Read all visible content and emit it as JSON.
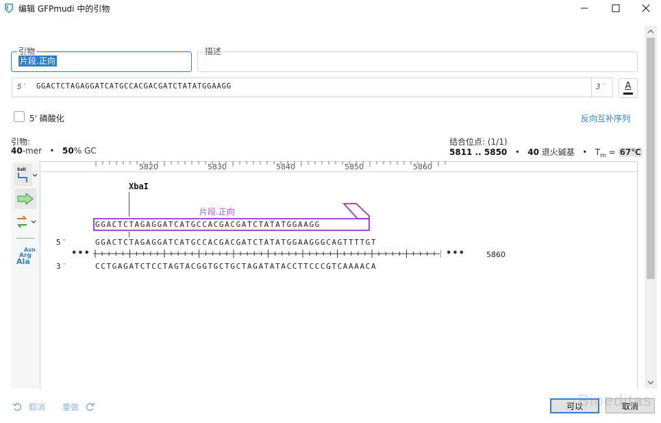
{
  "window": {
    "title": "编辑 GFPmudi 中的引物",
    "minimize_icon": "minimize-icon",
    "maximize_icon": "maximize-icon",
    "close_icon": "close-icon"
  },
  "primer_name": {
    "legend": "引物",
    "value": "片段.正向"
  },
  "description": {
    "legend": "描述",
    "value": ""
  },
  "sequence": {
    "five_prime": "5′",
    "value": "GGACTCTAGAGGATCATGCCACGACGATCTATATGGAAGG",
    "three_prime": "3′",
    "font_button": "A"
  },
  "phosphorylation": {
    "label": "5' 磷酸化",
    "checked": false
  },
  "reverse_complement_link": "反向互补序列",
  "stats": {
    "label": "引物:",
    "length": "40",
    "mer": "-mer",
    "bullet": "•",
    "gc_value": "50",
    "gc_unit": "% GC"
  },
  "binding": {
    "label": "结合位点: (1/1)",
    "range": "5811 .. 5850",
    "bullet1": "•",
    "anneal_count": "40",
    "anneal_label": "退火碱基",
    "bullet2": "•",
    "tm_label": "T",
    "tm_sub": "m",
    "tm_eq": "=",
    "tm_value": "67℃"
  },
  "map": {
    "ruler_ticks": [
      "5820",
      "5830",
      "5840",
      "5850",
      "5860"
    ],
    "enzyme": "XbaI",
    "primer_label": "片段.正向",
    "primer_seq": "GGACTCTAGAGGATCATGCCACGACGATCTATATGGAAGG",
    "strand5": "5′",
    "strand3": "3′",
    "top_seq": "GGACTCTAGAGGATCATGCCACGACGATCTATATGGAAGGGCAGTTTTGT",
    "bottom_seq": "CCTGAGATCTCCTAGTACGGTGCTGCTAGATATACCTTCCCGTCAAAACA",
    "dots_left": "•••",
    "dots_right": "•••",
    "position_label": "5860",
    "tools": {
      "enzyme_tool_label": "SalI",
      "aa_lines": [
        "Asn",
        "Arg",
        "Ala"
      ]
    },
    "colors": {
      "primer": "#9b30d9",
      "accent": "#2f7fc7"
    }
  },
  "footer": {
    "undo": "取消",
    "redo": "重做",
    "ok": "可以",
    "cancel": "取消",
    "watermark": "Bioeditas"
  }
}
